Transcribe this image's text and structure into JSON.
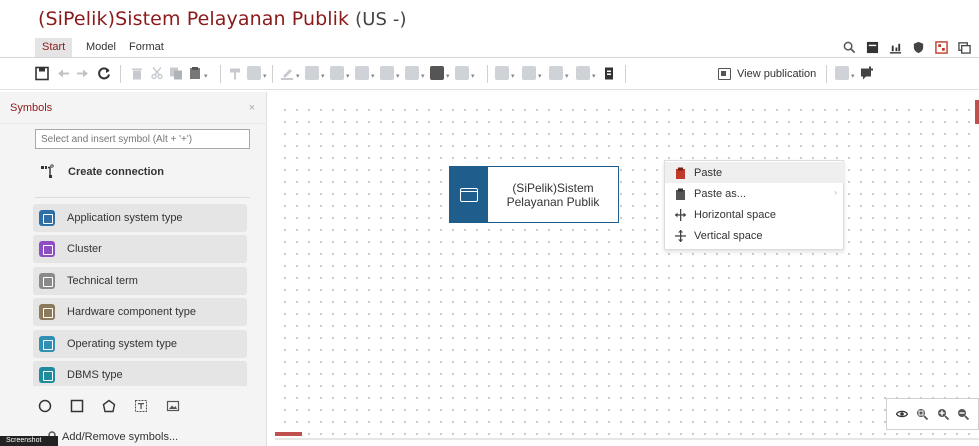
{
  "app": {
    "title": "(SiPelik)Sistem Pelayanan Publik",
    "language": "(US -)",
    "accent_color": "#8b1a1a",
    "node_color": "#1f5e8c"
  },
  "tabs": [
    {
      "label": "Start",
      "active": true
    },
    {
      "label": "Model",
      "active": false
    },
    {
      "label": "Format",
      "active": false
    }
  ],
  "header_icons": [
    "search-icon",
    "layout-icon",
    "chart-icon",
    "shield-icon",
    "symbol-palette-icon",
    "window-icon"
  ],
  "toolbar": {
    "view_publication_label": "View publication"
  },
  "symbols_panel": {
    "title": "Symbols",
    "close_glyph": "×",
    "search_placeholder": "Select and insert symbol (Alt + '+')",
    "create_connection_label": "Create connection",
    "items": [
      {
        "label": "Application system type",
        "color": "#2e6fa8"
      },
      {
        "label": "Cluster",
        "color": "#8e4ec6"
      },
      {
        "label": "Technical term",
        "color": "#8a8a8a"
      },
      {
        "label": "Hardware component type",
        "color": "#8c7a5a"
      },
      {
        "label": "Operating system type",
        "color": "#2f8fb5"
      },
      {
        "label": "DBMS type",
        "color": "#1e8c9e"
      }
    ],
    "shapes": [
      "circle-shape-icon",
      "square-shape-icon",
      "pentagon-shape-icon",
      "text-shape-icon",
      "image-shape-icon"
    ],
    "add_remove_label": "Add/Remove symbols...",
    "screenshot_tag": "Screenshot"
  },
  "canvas": {
    "node_label": "(SiPelik)Sistem Pelayanan Publik"
  },
  "context_menu": {
    "items": [
      {
        "label": "Paste",
        "icon": "paste-icon",
        "hover": true,
        "submenu": false
      },
      {
        "label": "Paste as...",
        "icon": "paste-as-icon",
        "hover": false,
        "submenu": true
      },
      {
        "label": "Horizontal space",
        "icon": "horizontal-space-icon",
        "hover": false,
        "submenu": false
      },
      {
        "label": "Vertical space",
        "icon": "vertical-space-icon",
        "hover": false,
        "submenu": false
      }
    ],
    "submenu_glyph": "›"
  },
  "zoom_panel": [
    "eye-icon",
    "zoom-fit-icon",
    "zoom-in-icon",
    "zoom-out-icon"
  ]
}
